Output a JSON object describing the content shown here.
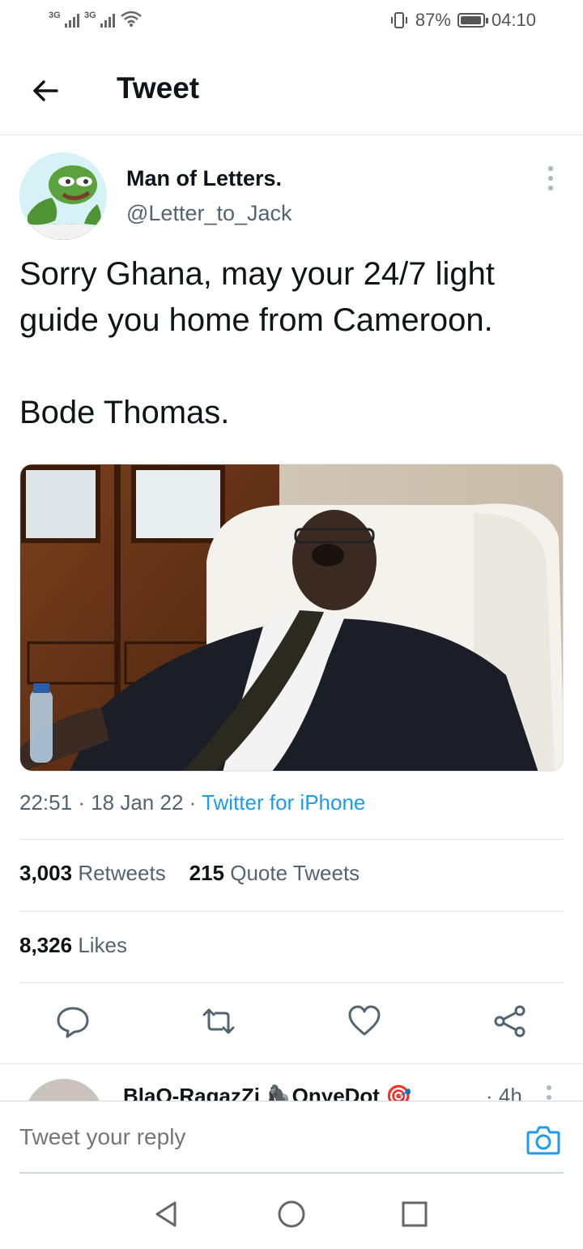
{
  "status_bar": {
    "sim1": "3G",
    "sim2": "3G",
    "battery": "87%",
    "time": "04:10"
  },
  "header": {
    "title": "Tweet",
    "back_icon": "arrow-left-icon"
  },
  "tweet": {
    "author_name": "Man of Letters.",
    "author_handle": "@Letter_to_Jack",
    "text": "Sorry Ghana, may your 24/7 light guide you home from Cameroon.\n\nBode Thomas.",
    "time": "22:51",
    "date": "18 Jan 22",
    "source": "Twitter for iPhone",
    "retweets_count": "3,003",
    "retweets_label": "Retweets",
    "quotes_count": "215",
    "quotes_label": "Quote Tweets",
    "likes_count": "8,326",
    "likes_label": "Likes"
  },
  "actions": {
    "reply_icon": "reply-icon",
    "retweet_icon": "retweet-icon",
    "like_icon": "heart-icon",
    "share_icon": "share-icon"
  },
  "reply_preview": {
    "name": "BlaQ-RagazZi 🦍OnyeDot 🎯",
    "time": "· 4h"
  },
  "compose": {
    "placeholder": "Tweet your reply"
  },
  "colors": {
    "accent": "#1d9bf0",
    "secondary_text": "#536471",
    "divider": "#e1e8ed"
  }
}
